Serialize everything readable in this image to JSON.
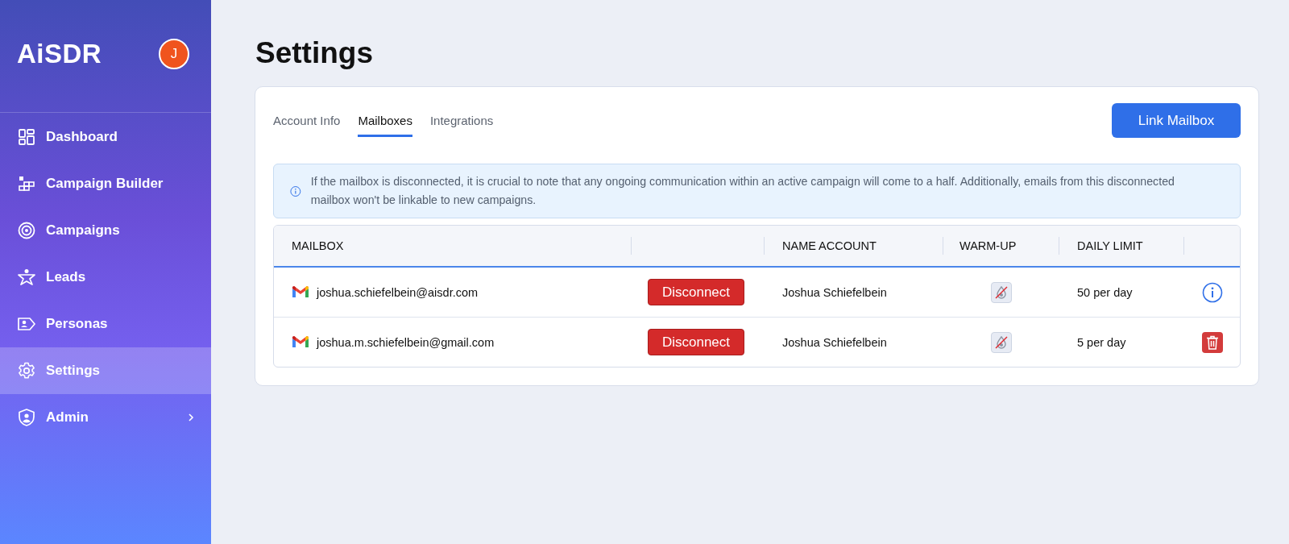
{
  "sidebar": {
    "logo": "AiSDR",
    "avatar": "J",
    "items": [
      {
        "label": "Dashboard",
        "selected": false,
        "expandable": false
      },
      {
        "label": "Campaign Builder",
        "selected": false,
        "expandable": false
      },
      {
        "label": "Campaigns",
        "selected": false,
        "expandable": false
      },
      {
        "label": "Leads",
        "selected": false,
        "expandable": false
      },
      {
        "label": "Personas",
        "selected": false,
        "expandable": false
      },
      {
        "label": "Settings",
        "selected": true,
        "expandable": false
      },
      {
        "label": "Admin",
        "selected": false,
        "expandable": true
      }
    ]
  },
  "page": {
    "title": "Settings"
  },
  "tabs": [
    {
      "label": "Account Info",
      "selected": false
    },
    {
      "label": "Mailboxes",
      "selected": true
    },
    {
      "label": "Integrations",
      "selected": false
    }
  ],
  "link_button": "Link Mailbox",
  "alert": "If the mailbox is disconnected, it is crucial to note that any ongoing communication within an active campaign will come to a half. Additionally, emails from this disconnected mailbox won't be linkable to new campaigns.",
  "table": {
    "columns": [
      "MAILBOX",
      "",
      "NAME ACCOUNT",
      "WARM-UP",
      "DAILY LIMIT",
      ""
    ],
    "rows": [
      {
        "email": "joshua.schiefelbein@aisdr.com",
        "button": "Disconnect",
        "name": "Joshua Schiefelbein",
        "warmup": false,
        "limit": "50 per day",
        "kind": "info"
      },
      {
        "email": "joshua.m.schiefelbein@gmail.com",
        "button": "Disconnect",
        "name": "Joshua Schiefelbein",
        "warmup": false,
        "limit": "5 per day",
        "kind": "delete"
      }
    ]
  }
}
